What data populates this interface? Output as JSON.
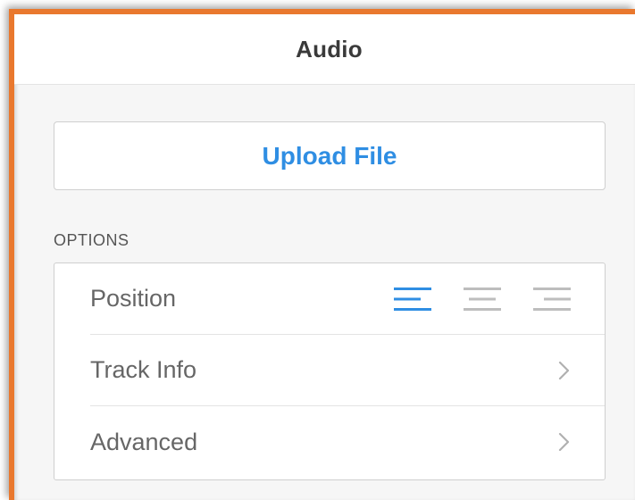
{
  "panel": {
    "title": "Audio"
  },
  "upload": {
    "label": "Upload File"
  },
  "options": {
    "section_label": "OPTIONS",
    "rows": [
      {
        "label": "Position",
        "control": "alignment",
        "selected": "left"
      },
      {
        "label": "Track Info",
        "control": "chevron-right-icon"
      },
      {
        "label": "Advanced",
        "control": "chevron-right-icon"
      }
    ]
  },
  "colors": {
    "accent": "#2f8ee3",
    "frame": "#e9782e",
    "inactive_icon": "#bdbdbd"
  }
}
